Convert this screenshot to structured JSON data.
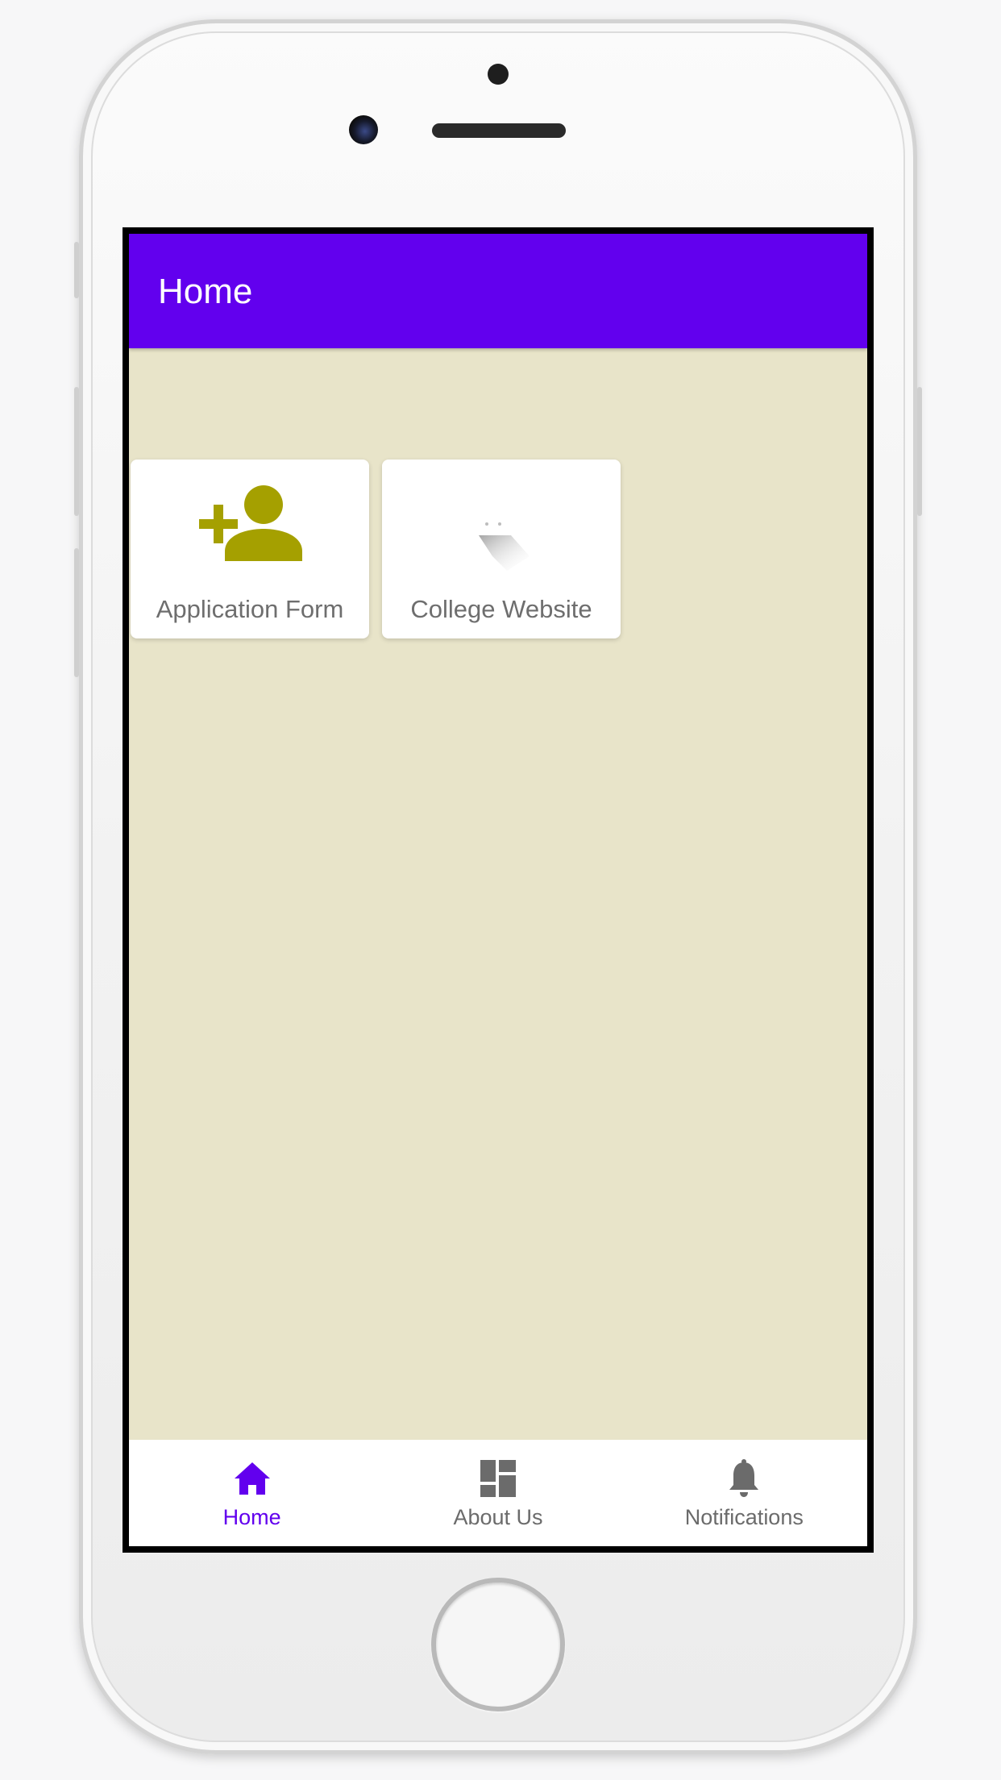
{
  "colors": {
    "primary": "#6200ee",
    "content_background": "#e8e4c9",
    "icon_olive": "#a5a000",
    "nav_inactive": "#6b6b6b"
  },
  "app_bar": {
    "title": "Home"
  },
  "tiles": [
    {
      "label": "Application Form",
      "icon": "add-person-icon"
    },
    {
      "label": "College Website",
      "icon": "website-icon"
    }
  ],
  "bottom_nav": {
    "items": [
      {
        "label": "Home",
        "icon": "home-icon",
        "active": true
      },
      {
        "label": "About Us",
        "icon": "dashboard-icon",
        "active": false
      },
      {
        "label": "Notifications",
        "icon": "bell-icon",
        "active": false
      }
    ]
  }
}
